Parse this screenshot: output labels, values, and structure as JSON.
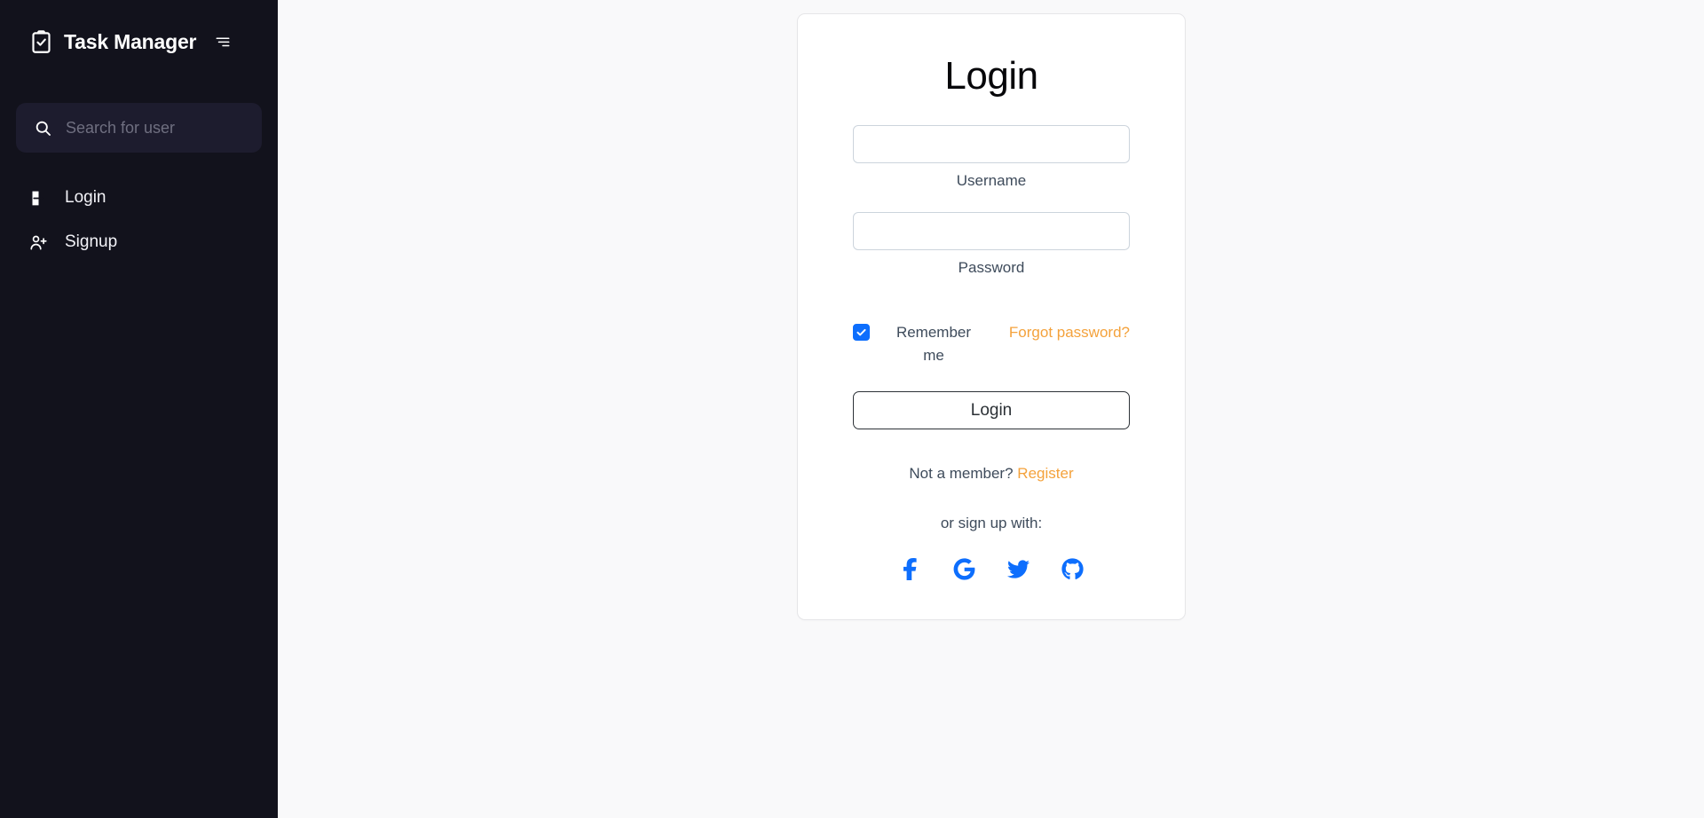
{
  "sidebar": {
    "brand": {
      "title": "Task Manager",
      "logo_icon": "clipboard-check-icon",
      "menu_icon": "hamburger-menu-icon"
    },
    "search": {
      "icon": "search-icon",
      "placeholder": "Search for user",
      "value": ""
    },
    "items": [
      {
        "label": "Login",
        "icon": "sign-in-icon"
      },
      {
        "label": "Signup",
        "icon": "user-plus-icon"
      }
    ],
    "background_color": "#12121c",
    "search_background_color": "#1d1c2e"
  },
  "main": {
    "background_color": "#f9f9fa",
    "card": {
      "title": "Login",
      "username": {
        "label": "Username",
        "value": "",
        "placeholder": ""
      },
      "password": {
        "label": "Password",
        "value": "",
        "placeholder": ""
      },
      "remember": {
        "label": "Remember me",
        "checked": true,
        "checkbox_color": "#0d6efd"
      },
      "forgot_password": {
        "label": "Forgot password?",
        "color": "#f4a23c"
      },
      "submit": {
        "label": "Login"
      },
      "member_prompt": {
        "text": "Not a member?",
        "link_label": "Register",
        "link_color": "#f4a23c"
      },
      "social_heading": "or sign up with:",
      "socials": [
        {
          "name": "facebook",
          "icon": "facebook-icon",
          "color": "#0d6efd"
        },
        {
          "name": "google",
          "icon": "google-icon",
          "color": "#0d6efd"
        },
        {
          "name": "twitter",
          "icon": "twitter-icon",
          "color": "#0d6efd"
        },
        {
          "name": "github",
          "icon": "github-icon",
          "color": "#0d6efd"
        }
      ]
    }
  }
}
